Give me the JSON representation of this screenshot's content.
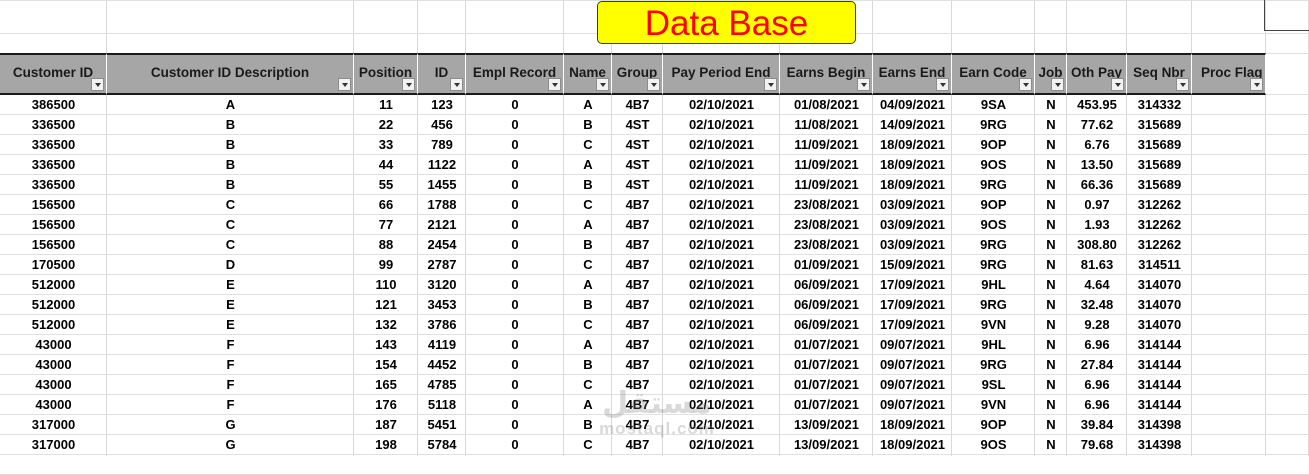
{
  "title": "Data Base",
  "columns": [
    {
      "key": "cust",
      "label": "Customer ID"
    },
    {
      "key": "desc",
      "label": "Customer ID Description"
    },
    {
      "key": "pos",
      "label": "Position"
    },
    {
      "key": "id",
      "label": "ID"
    },
    {
      "key": "empl",
      "label": "Empl Record"
    },
    {
      "key": "name",
      "label": "Name"
    },
    {
      "key": "group",
      "label": "Group"
    },
    {
      "key": "ppe",
      "label": "Pay Period End"
    },
    {
      "key": "eb",
      "label": "Earns Begin"
    },
    {
      "key": "ee",
      "label": "Earns End"
    },
    {
      "key": "code",
      "label": "Earn Code"
    },
    {
      "key": "job",
      "label": "Job"
    },
    {
      "key": "oth",
      "label": "Oth Pay"
    },
    {
      "key": "seq",
      "label": "Seq Nbr"
    },
    {
      "key": "proc",
      "label": "Proc Flag"
    }
  ],
  "rows": [
    [
      "386500",
      "A",
      "11",
      "123",
      "0",
      "A",
      "4B7",
      "02/10/2021",
      "01/08/2021",
      "04/09/2021",
      "9SA",
      "N",
      "453.95",
      "314332"
    ],
    [
      "336500",
      "B",
      "22",
      "456",
      "0",
      "B",
      "4ST",
      "02/10/2021",
      "11/08/2021",
      "14/09/2021",
      "9RG",
      "N",
      "77.62",
      "315689"
    ],
    [
      "336500",
      "B",
      "33",
      "789",
      "0",
      "C",
      "4ST",
      "02/10/2021",
      "11/09/2021",
      "18/09/2021",
      "9OP",
      "N",
      "6.76",
      "315689"
    ],
    [
      "336500",
      "B",
      "44",
      "1122",
      "0",
      "A",
      "4ST",
      "02/10/2021",
      "11/09/2021",
      "18/09/2021",
      "9OS",
      "N",
      "13.50",
      "315689"
    ],
    [
      "336500",
      "B",
      "55",
      "1455",
      "0",
      "B",
      "4ST",
      "02/10/2021",
      "11/09/2021",
      "18/09/2021",
      "9RG",
      "N",
      "66.36",
      "315689"
    ],
    [
      "156500",
      "C",
      "66",
      "1788",
      "0",
      "C",
      "4B7",
      "02/10/2021",
      "23/08/2021",
      "03/09/2021",
      "9OP",
      "N",
      "0.97",
      "312262"
    ],
    [
      "156500",
      "C",
      "77",
      "2121",
      "0",
      "A",
      "4B7",
      "02/10/2021",
      "23/08/2021",
      "03/09/2021",
      "9OS",
      "N",
      "1.93",
      "312262"
    ],
    [
      "156500",
      "C",
      "88",
      "2454",
      "0",
      "B",
      "4B7",
      "02/10/2021",
      "23/08/2021",
      "03/09/2021",
      "9RG",
      "N",
      "308.80",
      "312262"
    ],
    [
      "170500",
      "D",
      "99",
      "2787",
      "0",
      "C",
      "4B7",
      "02/10/2021",
      "01/09/2021",
      "15/09/2021",
      "9RG",
      "N",
      "81.63",
      "314511"
    ],
    [
      "512000",
      "E",
      "110",
      "3120",
      "0",
      "A",
      "4B7",
      "02/10/2021",
      "06/09/2021",
      "17/09/2021",
      "9HL",
      "N",
      "4.64",
      "314070"
    ],
    [
      "512000",
      "E",
      "121",
      "3453",
      "0",
      "B",
      "4B7",
      "02/10/2021",
      "06/09/2021",
      "17/09/2021",
      "9RG",
      "N",
      "32.48",
      "314070"
    ],
    [
      "512000",
      "E",
      "132",
      "3786",
      "0",
      "C",
      "4B7",
      "02/10/2021",
      "06/09/2021",
      "17/09/2021",
      "9VN",
      "N",
      "9.28",
      "314070"
    ],
    [
      "43000",
      "F",
      "143",
      "4119",
      "0",
      "A",
      "4B7",
      "02/10/2021",
      "01/07/2021",
      "09/07/2021",
      "9HL",
      "N",
      "6.96",
      "314144"
    ],
    [
      "43000",
      "F",
      "154",
      "4452",
      "0",
      "B",
      "4B7",
      "02/10/2021",
      "01/07/2021",
      "09/07/2021",
      "9RG",
      "N",
      "27.84",
      "314144"
    ],
    [
      "43000",
      "F",
      "165",
      "4785",
      "0",
      "C",
      "4B7",
      "02/10/2021",
      "01/07/2021",
      "09/07/2021",
      "9SL",
      "N",
      "6.96",
      "314144"
    ],
    [
      "43000",
      "F",
      "176",
      "5118",
      "0",
      "A",
      "4B7",
      "02/10/2021",
      "01/07/2021",
      "09/07/2021",
      "9VN",
      "N",
      "6.96",
      "314144"
    ],
    [
      "317000",
      "G",
      "187",
      "5451",
      "0",
      "B",
      "4B7",
      "02/10/2021",
      "13/09/2021",
      "18/09/2021",
      "9OP",
      "N",
      "39.84",
      "314398"
    ],
    [
      "317000",
      "G",
      "198",
      "5784",
      "0",
      "C",
      "4B7",
      "02/10/2021",
      "13/09/2021",
      "18/09/2021",
      "9OS",
      "N",
      "79.68",
      "314398"
    ]
  ],
  "watermark": {
    "arabic": "مستقل",
    "latin": "mostaql.com"
  }
}
